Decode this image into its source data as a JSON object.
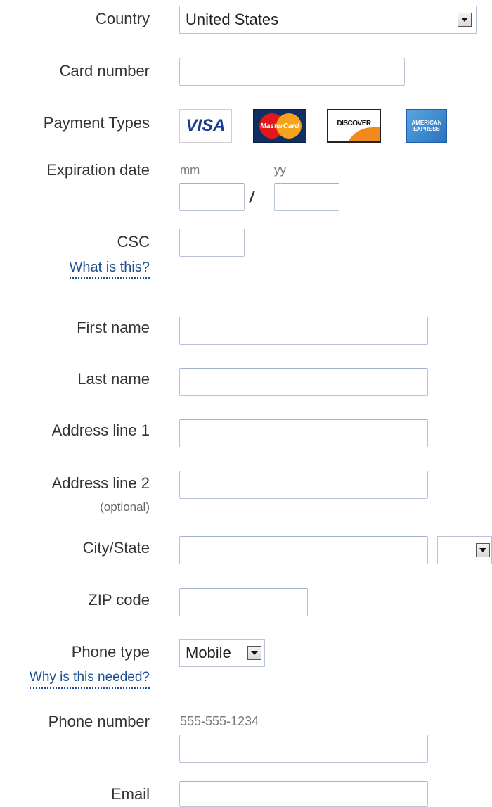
{
  "country": {
    "label": "Country",
    "selected": "United States"
  },
  "card_number": {
    "label": "Card number",
    "value": ""
  },
  "payment_types": {
    "label": "Payment Types",
    "cards": [
      {
        "name": "visa",
        "text": "VISA",
        "color": "#1a3d8f"
      },
      {
        "name": "mastercard",
        "text": "MasterCard",
        "color": "#0f2e62"
      },
      {
        "name": "discover",
        "text": "DISCOVER",
        "color": "#f08a1d"
      },
      {
        "name": "amex",
        "text": "AMERICAN EXPRESS",
        "color": "#2a72c0"
      }
    ]
  },
  "expiration": {
    "label": "Expiration date",
    "mm_hint": "mm",
    "yy_hint": "yy",
    "separator": "/",
    "mm_value": "",
    "yy_value": ""
  },
  "csc": {
    "label": "CSC",
    "help_link": "What is this?",
    "value": ""
  },
  "first_name": {
    "label": "First name",
    "value": ""
  },
  "last_name": {
    "label": "Last name",
    "value": ""
  },
  "address_line_1": {
    "label": "Address line 1",
    "value": ""
  },
  "address_line_2": {
    "label": "Address line 2",
    "optional": "(optional)",
    "value": ""
  },
  "city_state": {
    "label": "City/State",
    "city_value": "",
    "state_selected": ""
  },
  "zip": {
    "label": "ZIP code",
    "value": ""
  },
  "phone_type": {
    "label": "Phone type",
    "selected": "Mobile",
    "help_link": "Why is this needed?"
  },
  "phone_number": {
    "label": "Phone number",
    "hint": "555-555-1234",
    "value": ""
  },
  "email": {
    "label": "Email",
    "value": ""
  },
  "colors": {
    "link": "#1a4f95",
    "input_border": "#b9c4d6",
    "label_text": "#333333"
  }
}
